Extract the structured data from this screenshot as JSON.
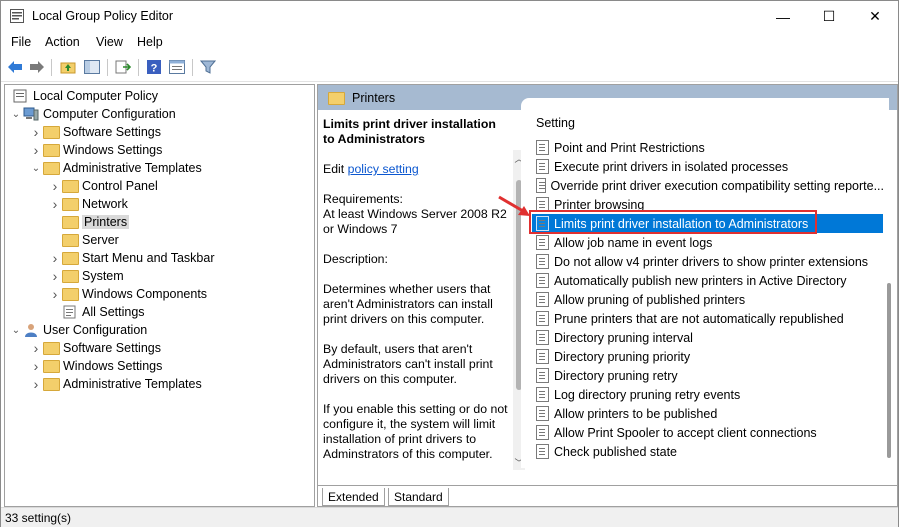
{
  "window": {
    "title": "Local Group Policy Editor"
  },
  "window_controls": {
    "minimize": "—",
    "maximize": "☐",
    "close": "✕"
  },
  "menu": [
    "File",
    "Action",
    "View",
    "Help"
  ],
  "tree": [
    {
      "label": "Local Computer Policy",
      "level": 0,
      "icon": "computer-policy-icon",
      "expand": ""
    },
    {
      "label": "Computer Configuration",
      "level": 0,
      "icon": "computer-icon",
      "expand": "open"
    },
    {
      "label": "Software Settings",
      "level": 1,
      "icon": "folder-icon",
      "expand": "closed"
    },
    {
      "label": "Windows Settings",
      "level": 1,
      "icon": "folder-icon",
      "expand": "closed"
    },
    {
      "label": "Administrative Templates",
      "level": 1,
      "icon": "folder-icon",
      "expand": "open"
    },
    {
      "label": "Control Panel",
      "level": 2,
      "icon": "folder-icon",
      "expand": "closed"
    },
    {
      "label": "Network",
      "level": 2,
      "icon": "folder-icon",
      "expand": "closed"
    },
    {
      "label": "Printers",
      "level": 2,
      "icon": "folder-icon",
      "expand": "",
      "selected": true
    },
    {
      "label": "Server",
      "level": 2,
      "icon": "folder-icon",
      "expand": ""
    },
    {
      "label": "Start Menu and Taskbar",
      "level": 2,
      "icon": "folder-icon",
      "expand": "closed"
    },
    {
      "label": "System",
      "level": 2,
      "icon": "folder-icon",
      "expand": "closed"
    },
    {
      "label": "Windows Components",
      "level": 2,
      "icon": "folder-icon",
      "expand": "closed"
    },
    {
      "label": "All Settings",
      "level": 2,
      "icon": "settings-icon",
      "expand": ""
    },
    {
      "label": "User Configuration",
      "level": 0,
      "icon": "user-icon",
      "expand": "open"
    },
    {
      "label": "Software Settings",
      "level": 1,
      "icon": "folder-icon",
      "expand": "closed"
    },
    {
      "label": "Windows Settings",
      "level": 1,
      "icon": "folder-icon",
      "expand": "closed"
    },
    {
      "label": "Administrative Templates",
      "level": 1,
      "icon": "folder-icon",
      "expand": "closed"
    }
  ],
  "right_header": {
    "label": "Printers"
  },
  "description": {
    "title": "Limits print driver installation to Administrators",
    "edit_prefix": "Edit ",
    "edit_link": "policy setting",
    "requirements": "Requirements:\nAt least Windows Server 2008 R2 or Windows 7",
    "desc_label": "Description:",
    "p1": "Determines whether users that aren't Administrators can install print drivers on this computer.",
    "p2": "By default, users that aren't Administrators can't install print drivers on this computer.",
    "p3": "If you enable this setting or do not configure it, the system will limit installation of print drivers to Adminstrators of this computer."
  },
  "settings_header": "Setting",
  "settings": [
    "Point and Print Restrictions",
    "Execute print drivers in isolated processes",
    "Override print driver execution compatibility setting reporte...",
    "Printer browsing",
    "Limits print driver installation to Administrators",
    "Allow job name in event logs",
    "Do not allow v4 printer drivers to show printer extensions",
    "Automatically publish new printers in Active Directory",
    "Allow pruning of published printers",
    "Prune printers that are not automatically republished",
    "Directory pruning interval",
    "Directory pruning priority",
    "Directory pruning retry",
    "Log directory pruning retry events",
    "Allow printers to be published",
    "Allow Print Spooler to accept client connections",
    "Check published state"
  ],
  "selected_setting_index": 4,
  "tabs": [
    "Extended",
    "Standard"
  ],
  "status": "33 setting(s)",
  "colors": {
    "selection": "#0078d7",
    "header": "#a6bad1",
    "highlight_box": "#e03030",
    "folder": "#f3cf6b"
  }
}
